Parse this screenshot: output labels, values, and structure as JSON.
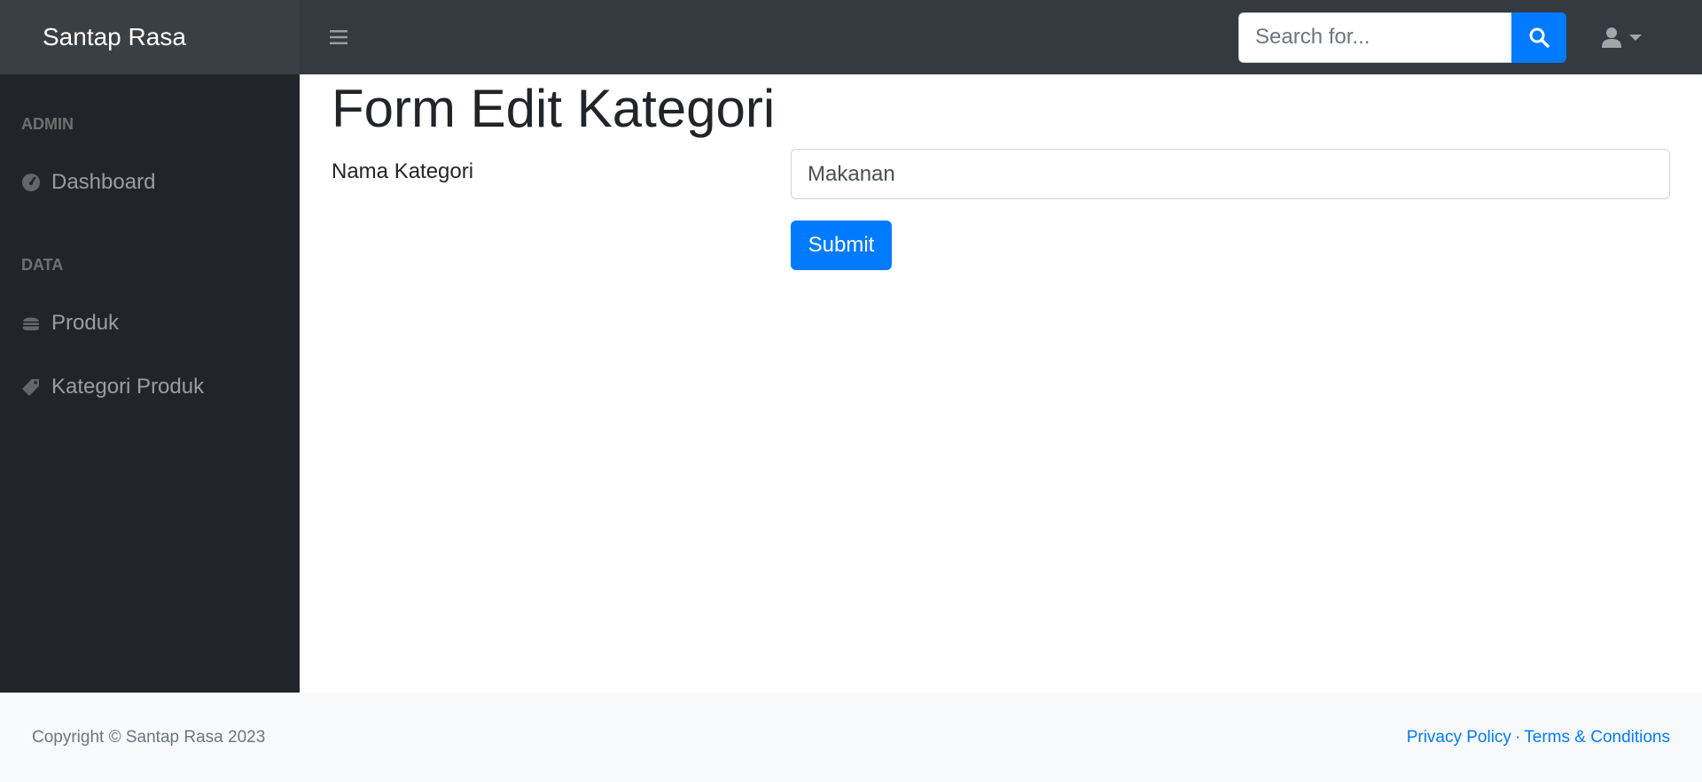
{
  "brand": {
    "name": "Santap Rasa"
  },
  "topnav": {
    "toggle_icon": "hamburger-icon",
    "search_placeholder": "Search for...",
    "search_icon": "search-icon",
    "user_icon": "user-icon"
  },
  "sidebar": {
    "sections": [
      {
        "heading": "ADMIN",
        "items": [
          {
            "label": "Dashboard",
            "icon": "tachometer-icon"
          }
        ]
      },
      {
        "heading": "DATA",
        "items": [
          {
            "label": "Produk",
            "icon": "hamburger-food-icon"
          },
          {
            "label": "Kategori Produk",
            "icon": "tag-icon"
          }
        ]
      }
    ]
  },
  "main": {
    "title": "Form Edit Kategori",
    "field_label": "Nama Kategori",
    "field_value": "Makanan",
    "submit_label": "Submit"
  },
  "footer": {
    "copyright": "Copyright © Santap Rasa 2023",
    "privacy": "Privacy Policy",
    "separator": "·",
    "terms": "Terms & Conditions"
  },
  "colors": {
    "topnav_bg": "#343a40",
    "sidebar_bg": "#212529",
    "primary": "#007bff",
    "footer_bg": "#f8f9fa"
  }
}
